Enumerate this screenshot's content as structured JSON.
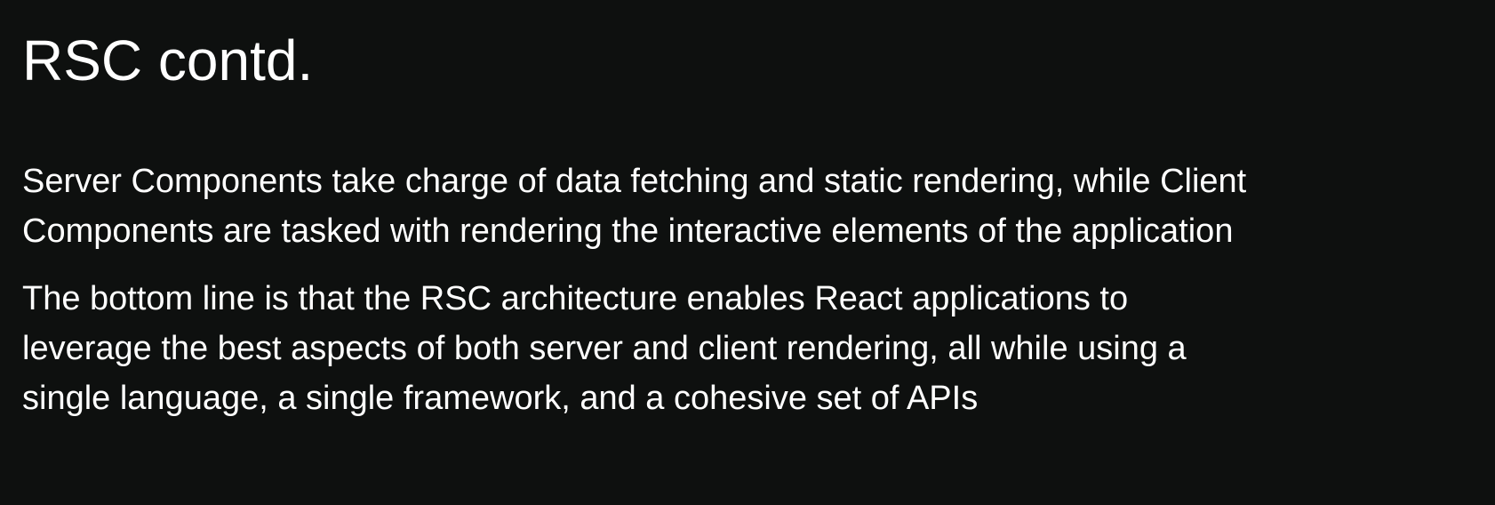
{
  "slide": {
    "title": "RSC contd.",
    "paragraphs": [
      {
        "lines": [
          "Server Components take charge of data fetching and static rendering, while Client",
          "Components are tasked with rendering the interactive elements of the application"
        ]
      },
      {
        "lines": [
          "The bottom line is that the RSC architecture enables React applications to",
          "leverage the best aspects of both server and client rendering, all while using a",
          "single language, a single framework, and a cohesive set of APIs"
        ]
      }
    ]
  },
  "colors": {
    "background": "#0e100f",
    "text": "#ffffff"
  }
}
